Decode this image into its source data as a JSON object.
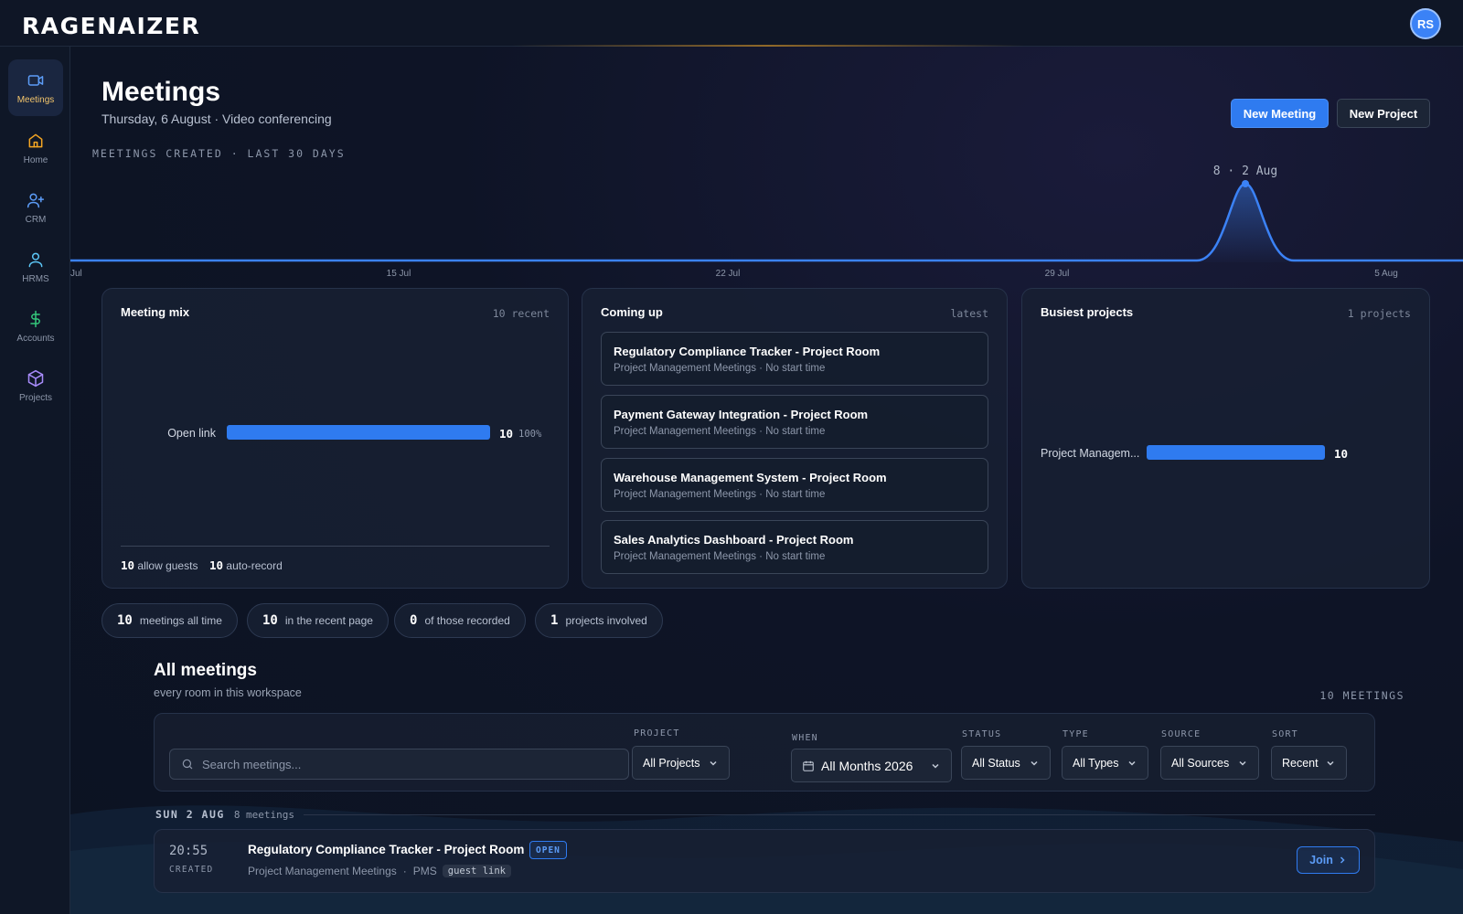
{
  "app": {
    "brand": "RAGENAIZER",
    "user_initials": "RS"
  },
  "sidebar": {
    "items": [
      {
        "label": "Meetings",
        "icon": "video-icon",
        "active": true
      },
      {
        "label": "Home",
        "icon": "home-icon"
      },
      {
        "label": "CRM",
        "icon": "user-plus-icon"
      },
      {
        "label": "HRMS",
        "icon": "user-icon"
      },
      {
        "label": "Accounts",
        "icon": "dollar-icon"
      },
      {
        "label": "Projects",
        "icon": "cube-icon"
      }
    ]
  },
  "header": {
    "title": "Meetings",
    "subtitle": "Thursday, 6 August · Video conferencing",
    "new_meeting": "New Meeting",
    "new_project": "New Project"
  },
  "chart_data": {
    "type": "area",
    "title": "MEETINGS CREATED · LAST 30 DAYS",
    "x_ticks": [
      "Jul",
      "15 Jul",
      "22 Jul",
      "29 Jul",
      "5 Aug"
    ],
    "peak_label": "8 · 2 Aug",
    "series": [
      {
        "x": "2 Aug",
        "y": 8
      }
    ],
    "accent": "#3b82f6"
  },
  "cards": {
    "mix": {
      "title": "Meeting mix",
      "note": "10 recent",
      "rows": [
        {
          "label": "Open link",
          "value": "10",
          "pct": "100%",
          "fraction": 1.0
        }
      ],
      "foot_guests_count": "10",
      "foot_guests_label": "allow guests",
      "foot_record_count": "10",
      "foot_record_label": "auto-record"
    },
    "upcoming": {
      "title": "Coming up",
      "note": "latest",
      "items": [
        {
          "title": "Regulatory Compliance Tracker - Project Room",
          "sub": "Project Management Meetings · No start time"
        },
        {
          "title": "Payment Gateway Integration - Project Room",
          "sub": "Project Management Meetings · No start time"
        },
        {
          "title": "Warehouse Management System - Project Room",
          "sub": "Project Management Meetings · No start time"
        },
        {
          "title": "Sales Analytics Dashboard - Project Room",
          "sub": "Project Management Meetings · No start time"
        }
      ]
    },
    "busiest": {
      "title": "Busiest projects",
      "note": "1 projects",
      "rows": [
        {
          "label": "Project Managem...",
          "value": "10",
          "fraction": 1.0
        }
      ]
    }
  },
  "stats": [
    {
      "value": "10",
      "label": "meetings all time"
    },
    {
      "value": "10",
      "label": "in the recent page"
    },
    {
      "value": "0",
      "label": "of those recorded"
    },
    {
      "value": "1",
      "label": "projects involved"
    }
  ],
  "all_meetings": {
    "title": "All meetings",
    "subtitle": "every room in this workspace",
    "count": "10 MEETINGS",
    "search_placeholder": "Search meetings...",
    "filters": {
      "project": {
        "label": "PROJECT",
        "value": "All Projects"
      },
      "when": {
        "label": "WHEN",
        "value": "All Months 2026"
      },
      "status": {
        "label": "STATUS",
        "value": "All Status"
      },
      "type": {
        "label": "TYPE",
        "value": "All Types"
      },
      "source": {
        "label": "SOURCE",
        "value": "All Sources"
      },
      "sort": {
        "label": "SORT",
        "value": "Recent"
      }
    },
    "group": {
      "date": "SUN 2 AUG",
      "count": "8 meetings"
    },
    "rows": [
      {
        "time": "20:55",
        "created": "CREATED",
        "title": "Regulatory Compliance Tracker - Project Room",
        "badge": "OPEN",
        "category": "Project Management Meetings",
        "source": "PMS",
        "tag": "guest link",
        "action": "Join"
      }
    ]
  }
}
